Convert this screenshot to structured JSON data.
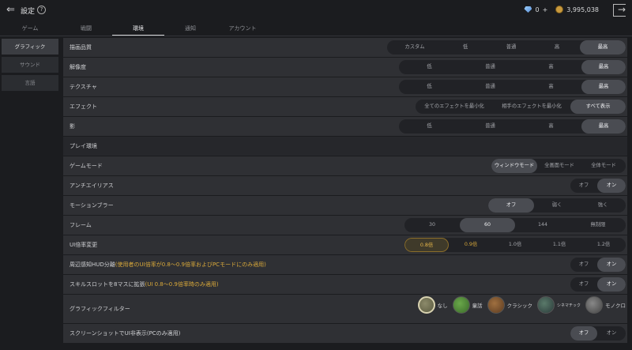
{
  "header": {
    "title": "設定",
    "help": "?",
    "gems": "0",
    "plus": "+",
    "gold": "3,995,038"
  },
  "tabs": [
    "ゲーム",
    "戦闘",
    "環境",
    "通知",
    "アカウント"
  ],
  "sidebar": [
    "グラフィック",
    "サウンド",
    "言語"
  ],
  "rows": [
    {
      "label": "描画品質",
      "options": [
        "カスタム",
        "低",
        "普通",
        "高",
        "最高"
      ],
      "selected": 4
    },
    {
      "label": "解像度",
      "options": [
        "低",
        "普通",
        "高",
        "最高"
      ],
      "selected": 3
    },
    {
      "label": "テクスチャ",
      "options": [
        "低",
        "普通",
        "高",
        "最高"
      ],
      "selected": 3
    },
    {
      "label": "エフェクト",
      "options": [
        "全てのエフェクトを最小化",
        "相手のエフェクトを最小化",
        "すべて表示"
      ],
      "selected": 2
    },
    {
      "label": "影",
      "options": [
        "低",
        "普通",
        "高",
        "最高"
      ],
      "selected": 3
    },
    {
      "label": "プレイ環境",
      "header": true
    },
    {
      "label": "ゲームモード",
      "options": [
        "ウィンドウモード",
        "全画面モード",
        "全体モード"
      ],
      "selected": 0
    },
    {
      "label": "アンチエイリアス",
      "options": [
        "オフ",
        "オン"
      ],
      "selected": 1
    },
    {
      "label": "モーションブラー",
      "options": [
        "オフ",
        "弱く",
        "強く"
      ],
      "selected": 0
    },
    {
      "label": "フレーム",
      "options": [
        "30",
        "60",
        "144",
        "無制限"
      ],
      "selected": 1
    },
    {
      "label": "UI倍率変更",
      "options": [
        "0.8倍",
        "0.9倍",
        "1.0倍",
        "1.1倍",
        "1.2倍"
      ],
      "selected": 0,
      "gold": [
        0,
        1
      ]
    },
    {
      "label": "周辺感知HUD分離",
      "note": "(使用者のUI倍率が0.8～0.9倍率およびPCモードにのみ適用)",
      "options": [
        "オフ",
        "オン"
      ],
      "selected": 1
    },
    {
      "label": "スキルスロットを8マスに拡張",
      "note": "(UI 0.8～0.9倍率時のみ適用)",
      "options": [
        "オフ",
        "オン"
      ],
      "selected": 1
    },
    {
      "label": "グラフィックフィルター",
      "filters": [
        "なし",
        "童話",
        "クラシック",
        "シネマチック",
        "モノクロ"
      ],
      "selected": 0
    },
    {
      "label": "スクリーンショットでUI非表示(PCのみ適用)",
      "options": [
        "オフ",
        "オン"
      ],
      "selected": 0
    }
  ],
  "colors": {
    "accent": "#d8a83a",
    "selected": "#4a4c52"
  }
}
